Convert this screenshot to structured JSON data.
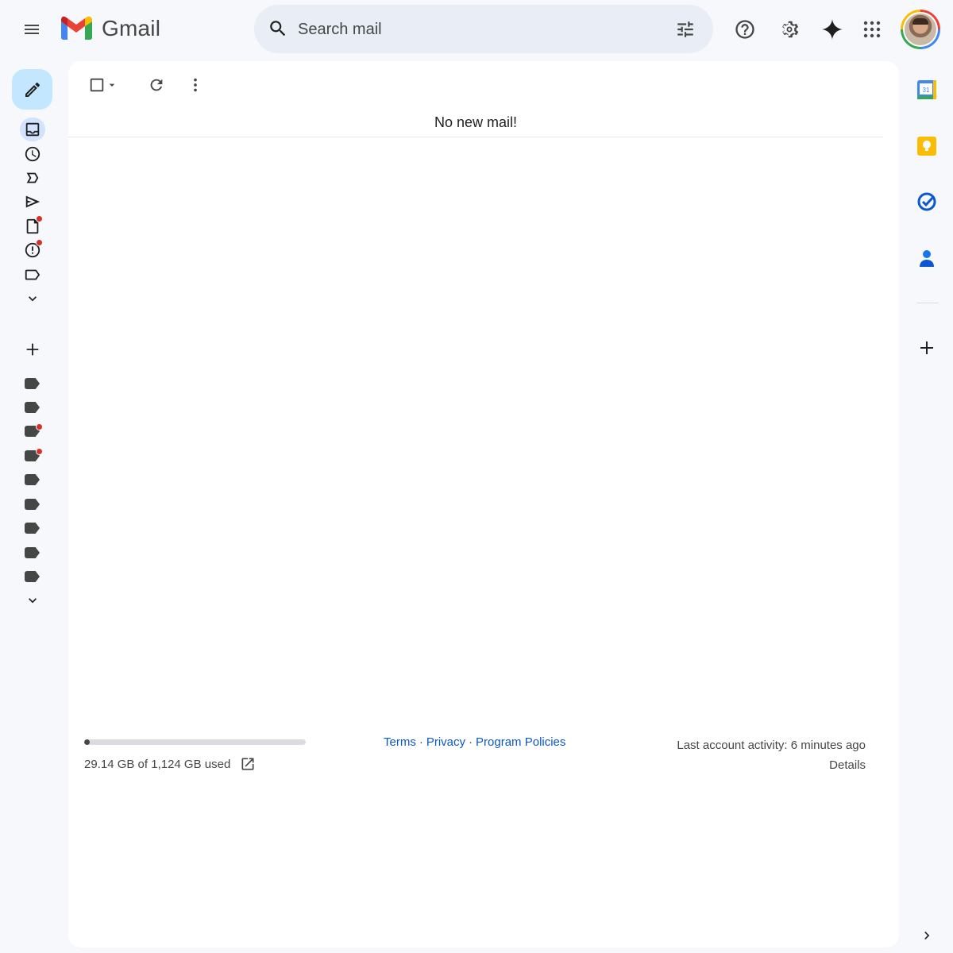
{
  "app": {
    "name": "Gmail"
  },
  "search": {
    "placeholder": "Search mail"
  },
  "main": {
    "empty_message": "No new mail!",
    "storage": {
      "used_text": "29.14 GB of 1,124 GB used",
      "used_fraction": 0.026
    },
    "footer_links": [
      {
        "label": "Terms"
      },
      {
        "label": "Privacy"
      },
      {
        "label": "Program Policies"
      }
    ],
    "activity": {
      "line1": "Last account activity: 6 minutes ago",
      "details": "Details"
    }
  },
  "nav": {
    "icons": [
      "inbox-icon",
      "snoozed-icon",
      "important-icon",
      "sent-icon",
      "drafts-icon",
      "spam-icon",
      "categories-icon",
      "more-icon"
    ],
    "label_count": 9
  },
  "side_panel": {
    "apps": [
      "calendar-icon",
      "keep-icon",
      "tasks-icon",
      "contacts-icon"
    ],
    "calendar_day": "31"
  },
  "colors": {
    "accent": "#0b57d0",
    "compose_bg": "#c2e7ff",
    "search_bg": "#e9eef6",
    "page_bg": "#f6f8fc",
    "badge": "#d93025"
  }
}
